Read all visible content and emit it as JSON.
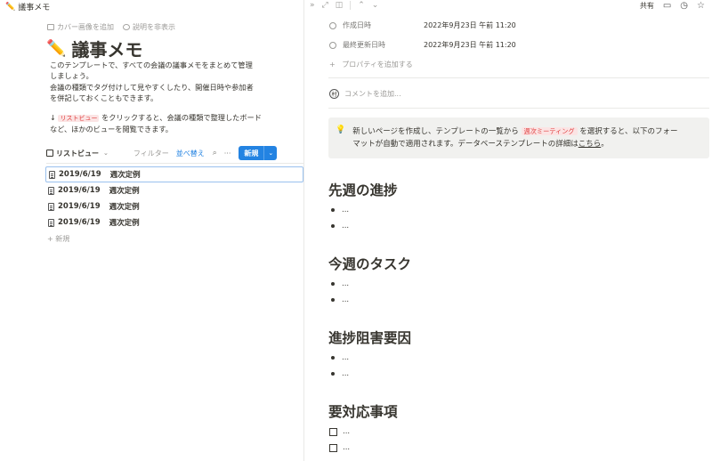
{
  "left": {
    "topbar_title": "議事メモ",
    "add_cover": "カバー画像を追加",
    "hide_description": "説明を非表示",
    "title_emoji": "✏️",
    "title": "議事メモ",
    "description_lines": [
      "このテンプレートで、すべての会議の議事メモをまとめて管理",
      "しましょう。",
      "会議の種類でタグ付けして見やすくしたり、開催日時や参加者",
      "を併記しておくこともできます。"
    ],
    "hint_arrow": "↓",
    "hint_tag": "リストビュー",
    "hint_line1_rest": "をクリックすると、会議の種類で整理したボード",
    "hint_line2": "など、ほかのビューを閲覧できます。",
    "view_name": "リストビュー",
    "filter_label": "フィルター",
    "sort_label": "並べ替え",
    "new_button": "新規",
    "items": [
      {
        "date": "2019/6/19",
        "name": "週次定例"
      },
      {
        "date": "2019/6/19",
        "name": "週次定例"
      },
      {
        "date": "2019/6/19",
        "name": "週次定例"
      },
      {
        "date": "2019/6/19",
        "name": "週次定例"
      }
    ],
    "add_new": "新規"
  },
  "right": {
    "share_label": "共有",
    "props": [
      {
        "name": "作成日時",
        "value": "2022年9月23日 午前 11:20"
      },
      {
        "name": "最終更新日時",
        "value": "2022年9月23日 午前 11:20"
      }
    ],
    "add_property": "プロパティを追加する",
    "avatar_initial": "村",
    "comment_placeholder": "コメントを追加...",
    "callout_text_1": "新しいページを作成し、テンプレートの一覧から",
    "callout_tag": "週次ミーティング",
    "callout_text_2": "を選択すると、以下のフォー",
    "callout_text_3": "マットが自動で適用されます。データベーステンプレートの詳細は",
    "callout_link": "こちら",
    "callout_text_4": "。",
    "sections": [
      {
        "heading": "先週の進捗",
        "items": [
          "...",
          "..."
        ]
      },
      {
        "heading": "今週のタスク",
        "items": [
          "...",
          "..."
        ]
      },
      {
        "heading": "進捗阻害要因",
        "items": [
          "...",
          "..."
        ]
      },
      {
        "heading": "要対応事項",
        "items": [
          "...",
          "..."
        ]
      }
    ]
  }
}
